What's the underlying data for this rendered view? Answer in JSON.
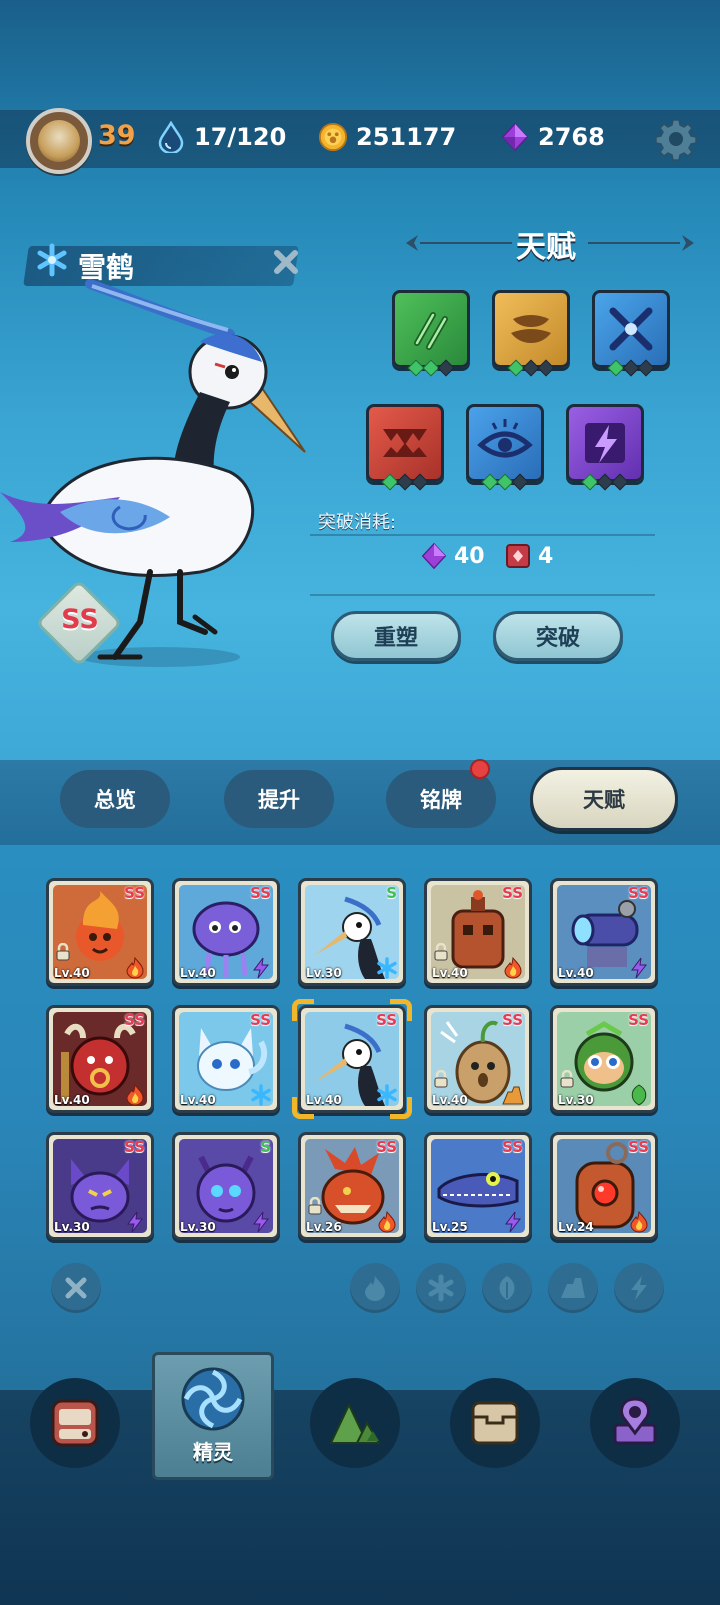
{
  "header": {
    "player_level": "39",
    "stamina": "17/120",
    "gold": "251177",
    "gems": "2768"
  },
  "creature": {
    "name": "雪鹤",
    "rank": "SS",
    "element_icon": "snowflake-icon"
  },
  "talent": {
    "title": "天赋",
    "tiles": [
      {
        "icon": "claw-slash-icon",
        "color": "#3ea54a",
        "pips": [
          1,
          1,
          0
        ]
      },
      {
        "icon": "bowl-stack-icon",
        "color": "#d6a245",
        "pips": [
          1,
          0,
          0
        ]
      },
      {
        "icon": "cross-blades-icon",
        "color": "#3a8ed6",
        "pips": [
          1,
          0,
          0
        ]
      },
      {
        "icon": "fangs-icon",
        "color": "#d24a3d",
        "pips": [
          1,
          0,
          0
        ]
      },
      {
        "icon": "eye-icon",
        "color": "#3b95d8",
        "pips": [
          1,
          1,
          0
        ]
      },
      {
        "icon": "lightning-icon",
        "color": "#8a4fd3",
        "pips": [
          1,
          0,
          0
        ]
      }
    ],
    "cost_label": "突破消耗:",
    "cost_gem": "40",
    "cost_book": "4",
    "reshape_label": "重塑",
    "breakthrough_label": "突破"
  },
  "tabs": [
    {
      "label": "总览",
      "active": false
    },
    {
      "label": "提升",
      "active": false
    },
    {
      "label": "铭牌",
      "active": false
    },
    {
      "label": "天赋",
      "active": true
    }
  ],
  "cards": [
    {
      "name": "fire-spirit",
      "level": "Lv.40",
      "grade": "SS",
      "element": "fire",
      "locked": true
    },
    {
      "name": "jellyfish",
      "level": "Lv.40",
      "grade": "SS",
      "element": "thunder",
      "locked": false
    },
    {
      "name": "crane",
      "level": "Lv.30",
      "grade": "S",
      "element": "ice",
      "locked": false
    },
    {
      "name": "rust-robot",
      "level": "Lv.40",
      "grade": "SS",
      "element": "fire",
      "locked": true
    },
    {
      "name": "cannon-bot",
      "level": "Lv.40",
      "grade": "SS",
      "element": "thunder",
      "locked": false
    },
    {
      "name": "bull-demon",
      "level": "Lv.40",
      "grade": "SS",
      "element": "fire",
      "locked": false
    },
    {
      "name": "ice-fox",
      "level": "Lv.40",
      "grade": "SS",
      "element": "ice",
      "locked": false
    },
    {
      "name": "snow-crane",
      "level": "Lv.40",
      "grade": "SS",
      "element": "ice",
      "locked": false,
      "selected": true
    },
    {
      "name": "potato-sprout",
      "level": "Lv.40",
      "grade": "SS",
      "element": "earth",
      "locked": true
    },
    {
      "name": "leaf-monkey",
      "level": "Lv.30",
      "grade": "SS",
      "element": "grass",
      "locked": true
    },
    {
      "name": "purple-bat",
      "level": "Lv.30",
      "grade": "SS",
      "element": "thunder",
      "locked": false
    },
    {
      "name": "purple-dragon",
      "level": "Lv.30",
      "grade": "S",
      "element": "thunder",
      "locked": false
    },
    {
      "name": "red-dragon",
      "level": "Lv.26",
      "grade": "SS",
      "element": "fire",
      "locked": true
    },
    {
      "name": "crocodile",
      "level": "Lv.25",
      "grade": "SS",
      "element": "thunder",
      "locked": false
    },
    {
      "name": "boiler-bot",
      "level": "Lv.24",
      "grade": "SS",
      "element": "fire",
      "locked": false
    }
  ],
  "filters": [
    "clear-filter-icon",
    "fire-filter-icon",
    "ice-filter-icon",
    "grass-filter-icon",
    "earth-filter-icon",
    "thunder-filter-icon"
  ],
  "nav": {
    "active_label": "精灵",
    "items": [
      "backpack-icon",
      "spirit-icon",
      "mountain-icon",
      "chest-icon",
      "map-pin-icon"
    ]
  }
}
